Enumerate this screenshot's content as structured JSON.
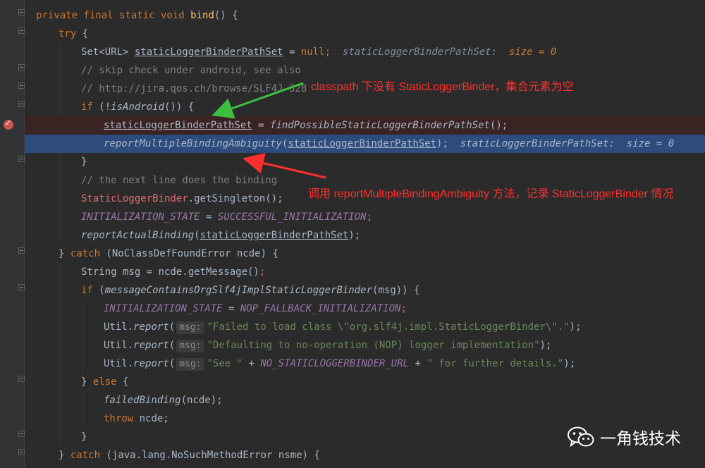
{
  "code": {
    "l1_kw": "private final static void",
    "l1_fn": "bind",
    "l1_tail": "() {",
    "l2_kw": "try",
    "l2_tail": " {",
    "l3_type": "Set<URL> ",
    "l3_var": "staticLoggerBinderPathSet",
    "l3_eq": " = ",
    "l3_null": "null",
    "l3_semi": ";",
    "l3_inline_name": "staticLoggerBinderPathSet:",
    "l3_inline_val": "size = 0",
    "l4_comment": "// skip check under android, see also",
    "l5_comment": "// http://jira.qos.ch/browse/SLF4J-328",
    "l6_kw": "if",
    "l6_a": " (!",
    "l6_fn": "isAndroid",
    "l6_b": "()) {",
    "l7_var": "staticLoggerBinderPathSet",
    "l7_eq": " = ",
    "l7_fn": "findPossibleStaticLoggerBinderPathSet",
    "l7_tail": "();",
    "l8_fn": "reportMultipleBindingAmbiguity",
    "l8_a": "(",
    "l8_var": "staticLoggerBinderPathSet",
    "l8_b": ");",
    "l8_inline_name": "staticLoggerBinderPathSet:",
    "l8_inline_val": "size = 0",
    "l9": "}",
    "l10_comment": "// the next line does the binding",
    "l11_cls": "StaticLoggerBinder",
    "l11_tail": ".getSingleton();",
    "l12_a": "INITIALIZATION_STATE",
    "l12_eq": " = ",
    "l12_b": "SUCCESSFUL_INITIALIZATION",
    "l12_semi": ";",
    "l13_fn": "reportActualBinding",
    "l13_a": "(",
    "l13_var": "staticLoggerBinderPathSet",
    "l13_b": ");",
    "l14_a": "} ",
    "l14_kw": "catch",
    "l14_b": " (NoClassDefFoundError ncde) {",
    "l15_a": "String msg = ncde.getMessage()",
    "l15_semi": ";",
    "l16_kw": "if",
    "l16_a": " (",
    "l16_fn": "messageContainsOrgSlf4jImplStaticLoggerBinder",
    "l16_b": "(msg)) {",
    "l17_a": "INITIALIZATION_STATE",
    "l17_eq": " = ",
    "l17_b": "NOP_FALLBACK_INITIALIZATION",
    "l17_semi": ";",
    "util": "Util.",
    "report": "report",
    "paren": "(",
    "hint": "msg:",
    "l18_str": "\"Failed to load class \\\"org.slf4j.impl.StaticLoggerBinder\\\".\"",
    "l19_str": "\"Defaulting to no-operation (NOP) logger implementation\"",
    "l20_str1": "\"See \"",
    "l20_plus1": " + ",
    "l20_const": "NO_STATICLOGGERBINDER_URL",
    "l20_plus2": " + ",
    "l20_str2": "\" for further details.\"",
    "close_semi": ");",
    "l21_a": "} ",
    "l21_kw": "else",
    "l21_b": " {",
    "l22_fn": "failedBinding",
    "l22_tail": "(ncde);",
    "l23_kw": "throw",
    "l23_tail": " ncde;",
    "l24": "}",
    "l25_a": "} ",
    "l25_kw": "catch",
    "l25_b": " (java.lang.NoSuchMethodError nsme) {"
  },
  "annotations": {
    "top": "classpath 下没有 StaticLoggerBinder，集合元素为空",
    "bottom": "调用 reportMultipleBindingAmbiguity 方法，记录 StaticLoggerBinder 情况"
  },
  "brand": {
    "name": "一角钱技术",
    "icon": "wechat-icon"
  },
  "colors": {
    "keyword": "#cc7832",
    "function": "#ffc66d",
    "string": "#6a8759",
    "static": "#9876aa",
    "comment": "#808080",
    "annotation": "#ff2f2f",
    "green_arrow": "#3fbf3f",
    "current_line": "#2d4c7d",
    "breakpoint": "#c75450"
  }
}
